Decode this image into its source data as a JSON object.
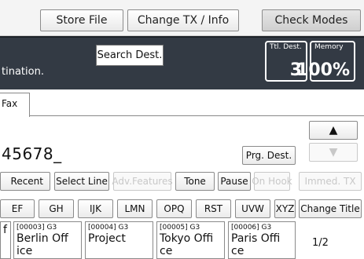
{
  "top_buttons": {
    "store_file": "Store File",
    "change_tx": "Change TX / Info",
    "check_modes": "Check Modes"
  },
  "header": {
    "message": "tination.",
    "search_dest": "Search Dest.",
    "ttl_dest_label": "Ttl. Dest.",
    "ttl_dest_value": "3",
    "memory_label": "Memory",
    "memory_value": "100%"
  },
  "tab": {
    "label": "Fax"
  },
  "entry": {
    "number": "45678_"
  },
  "buttons": {
    "prg_dest": "Prg. Dest.",
    "recent": "Recent",
    "select_line": "Select Line",
    "adv_features": "Adv.Features",
    "tone": "Tone",
    "pause": "Pause",
    "on_hook": "On Hook",
    "immed_tx": "Immed. TX",
    "change_title": "Change Title",
    "up_arrow": "▲",
    "down_arrow": "▼"
  },
  "title_tabs": [
    "EF",
    "GH",
    "IJK",
    "LMN",
    "OPQ",
    "RST",
    "UVW",
    "XYZ"
  ],
  "destinations": [
    {
      "code": "",
      "name": "f"
    },
    {
      "code": "[00003] G3",
      "name": "Berlin Off",
      "name2": "ice"
    },
    {
      "code": "[00004] G3",
      "name": "Project",
      "name2": ""
    },
    {
      "code": "[00005] G3",
      "name": "Tokyo Offi",
      "name2": "ce"
    },
    {
      "code": "[00006] G3",
      "name": "Paris Offi",
      "name2": "ce"
    }
  ],
  "page_indicator": "1/2"
}
